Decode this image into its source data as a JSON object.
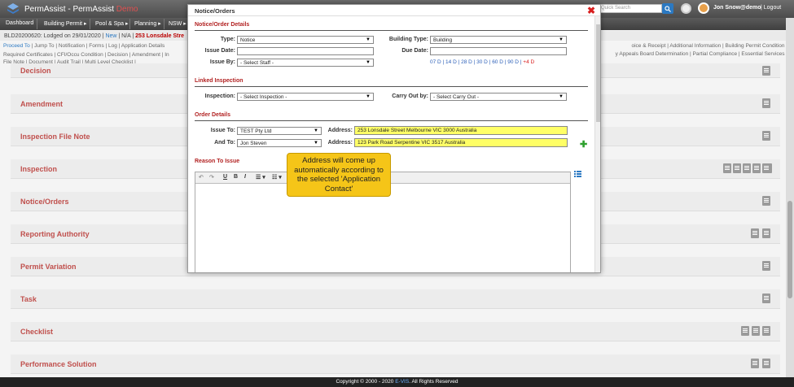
{
  "app": {
    "title": "PermAssist - PermAssist Demo",
    "title_prefix": "PermAssist - PermAssist ",
    "title_demo": "Demo",
    "search_placeholder": "Quick Search",
    "user_name": "Jon Snow@demo",
    "logout": "| Logout"
  },
  "nav": [
    "Dashboard",
    "Building Permit ▸",
    "Pool & Spa ▸",
    "Planning ▸",
    "NSW ▸"
  ],
  "infobar": {
    "prefix": "BLD20200620: Lodged on 29/01/2020 | ",
    "new": "New",
    "mid": " | N/A | ",
    "address": "253 Lonsdale Stre"
  },
  "links": {
    "row1_blue": "Proceed To",
    "row1_rest": "| Jump To | Notification | Forms | Log | Application Details",
    "row2": "Required Certificates | CFI/Occu Condition | Decision | Amendment | In",
    "row3": "File Note | Document | Audit Trail | Multi Level Checklist |",
    "right1": "oice & Receipt | Additional Information | Building Permit Condition |",
    "right2": "y Appeals Board Determination | Partial Compliance | Essential Services |"
  },
  "sections": [
    "Decision",
    "Amendment",
    "Inspection File Note",
    "Inspection",
    "Notice/Orders",
    "Reporting Authority",
    "Permit Variation",
    "Task",
    "Checklist",
    "Performance Solution"
  ],
  "footer": {
    "prefix": "Copyright © 2000 - 2020 ",
    "brand": "E-VIS",
    "suffix": ". All Rights Reserved"
  },
  "modal": {
    "title": "Notice/Orders",
    "details_heading": "Notice/Order Details",
    "type_label": "Type:",
    "type_value": "Notice",
    "building_type_label": "Building Type:",
    "building_type_value": "Building",
    "issue_date_label": "Issue Date:",
    "due_date_label": "Due Date:",
    "issue_by_label": "Issue By:",
    "issue_by_value": "- Select Staff -",
    "day_links": [
      "07 D",
      "14 D",
      "28 D",
      "30 D",
      "60 D",
      "90 D"
    ],
    "day_plus": "+4 D",
    "linked_heading": "Linked Inspection",
    "inspection_label": "Inspection:",
    "inspection_value": "- Select Inspection -",
    "carry_out_label": "Carry Out by:",
    "carry_out_value": "- Select Carry Out -",
    "order_heading": "Order Details",
    "issue_to_label": "Issue To:",
    "issue_to_value": "TEST Pty Ltd",
    "address_label": "Address:",
    "address1": "253 Lonsdale Street Melbourne VIC 3000 Australia",
    "and_to_label": "And To:",
    "and_to_value": "Jon Steven",
    "address2": "123 Park Road Serpentine VIC 3517 Australia",
    "reason_heading": "Reason To Issue",
    "toolbar": [
      "↶",
      "↷",
      "U",
      "B",
      "I",
      "☰ ▾",
      "☷ ▾"
    ]
  },
  "callout": "Address will come up automatically according to the selected 'Application Contact'"
}
